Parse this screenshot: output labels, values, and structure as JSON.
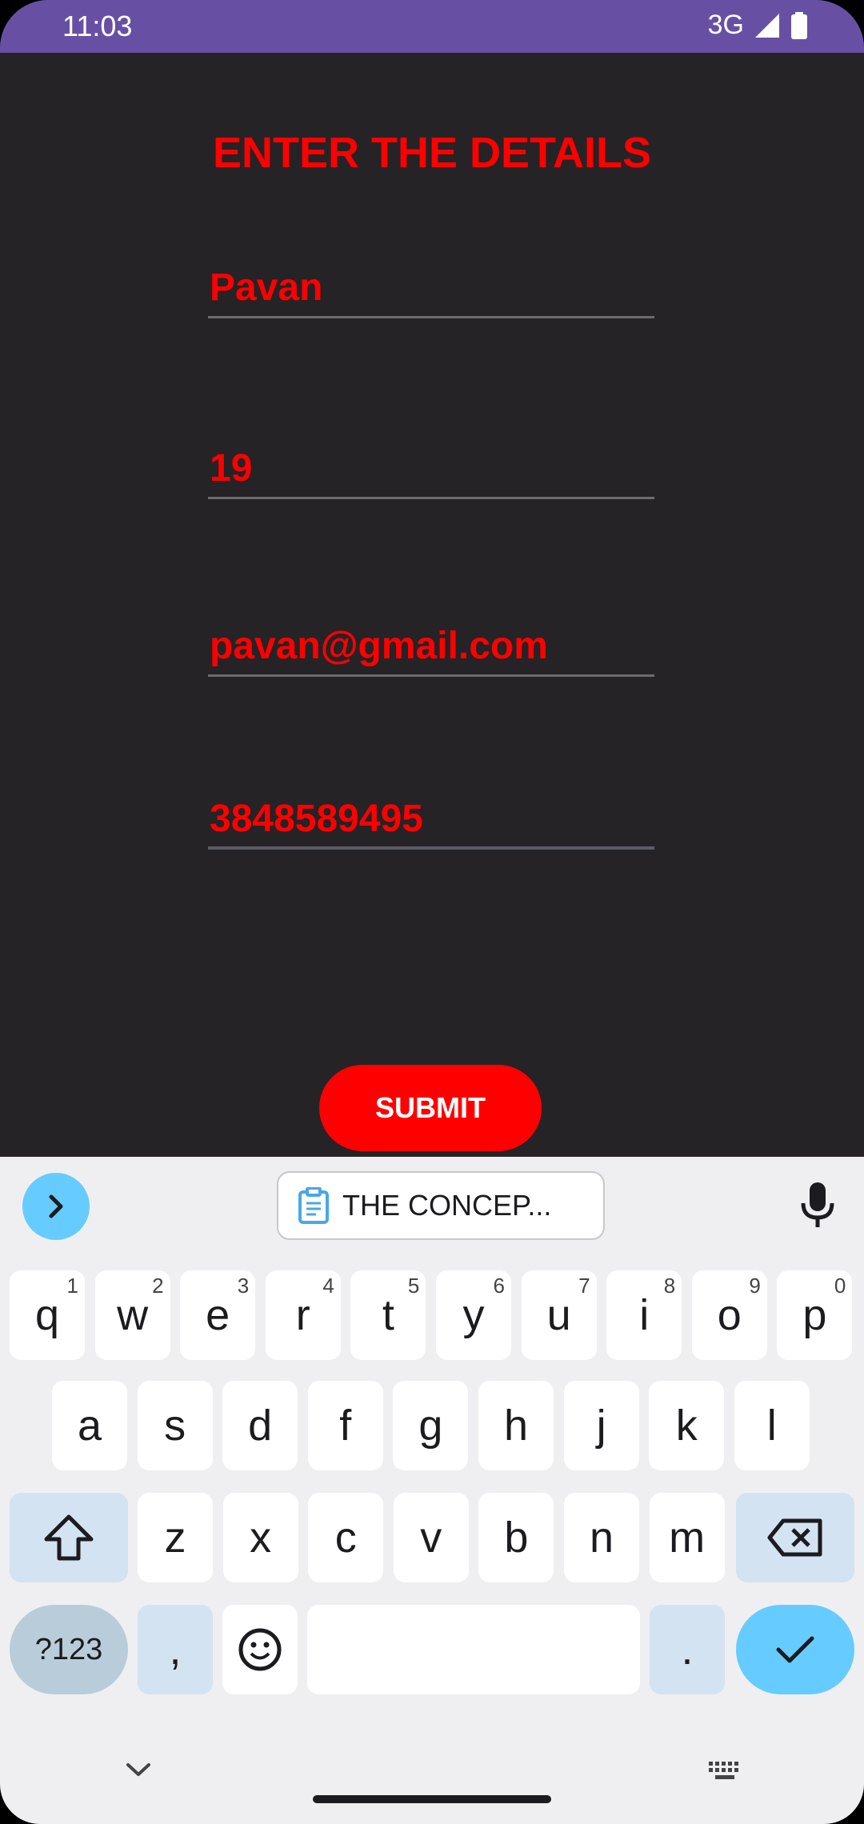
{
  "status": {
    "time": "11:03",
    "network": "3G"
  },
  "form": {
    "title": "ENTER THE DETAILS",
    "name_value": "Pavan",
    "age_value": "19",
    "email_value": "pavan@gmail.com",
    "phone_value": "3848589495",
    "submit_label": "SUBMIT"
  },
  "keyboard": {
    "clipboard_chip": "THE CONCEP...",
    "row1": [
      {
        "k": "q",
        "h": "1"
      },
      {
        "k": "w",
        "h": "2"
      },
      {
        "k": "e",
        "h": "3"
      },
      {
        "k": "r",
        "h": "4"
      },
      {
        "k": "t",
        "h": "5"
      },
      {
        "k": "y",
        "h": "6"
      },
      {
        "k": "u",
        "h": "7"
      },
      {
        "k": "i",
        "h": "8"
      },
      {
        "k": "o",
        "h": "9"
      },
      {
        "k": "p",
        "h": "0"
      }
    ],
    "row2": [
      "a",
      "s",
      "d",
      "f",
      "g",
      "h",
      "j",
      "k",
      "l"
    ],
    "row3": [
      "z",
      "x",
      "c",
      "v",
      "b",
      "n",
      "m"
    ],
    "symbols_label": "?123",
    "comma_label": ",",
    "period_label": ".",
    "accent_color": "#66ccff"
  }
}
